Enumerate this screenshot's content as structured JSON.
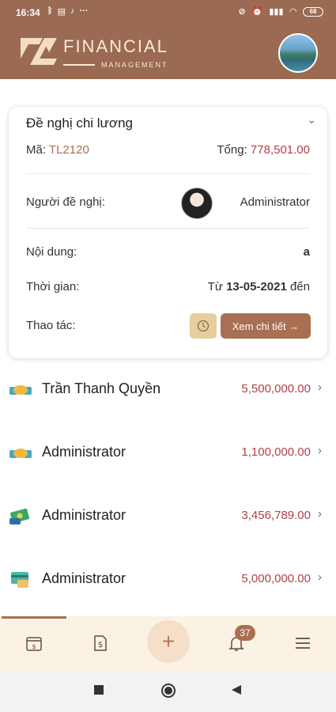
{
  "status_bar": {
    "time": "16:34",
    "left_icons": [
      "bluetooth-icon",
      "notes-icon",
      "tiktok-icon",
      "more-dots-icon"
    ],
    "right_icons": [
      "sync-off-icon",
      "alarm-icon",
      "signal-icon",
      "wifi-icon",
      "battery-icon"
    ],
    "battery_level": "68"
  },
  "header": {
    "brand_title": "FINANCIAL",
    "brand_subtitle": "MANAGEMENT"
  },
  "card": {
    "title": "Đề nghị chi lương",
    "code_label": "Mã:",
    "code_value": "TL2120",
    "total_label": "Tổng:",
    "total_value": "778,501.00",
    "requester_label": "Người đề nghị:",
    "requester_name": "Administrator",
    "content_label": "Nội dung:",
    "content_value": "a",
    "time_label": "Thời gian:",
    "time_from": "Từ",
    "time_date": "13-05-2021",
    "time_to": "đến",
    "action_label": "Thao tác:",
    "detail_button": "Xem chi tiết →"
  },
  "list": [
    {
      "name": "Trần Thanh Quyền",
      "amount": "5,500,000.00",
      "icon": "handshake-icon"
    },
    {
      "name": "Administrator",
      "amount": "1,100,000.00",
      "icon": "handshake-icon"
    },
    {
      "name": "Administrator",
      "amount": "3,456,789.00",
      "icon": "cash-icon"
    },
    {
      "name": "Administrator",
      "amount": "5,000,000.00",
      "icon": "card-payment-icon"
    }
  ],
  "bottom_nav": {
    "notification_count": "37",
    "plus_label": "+"
  },
  "colors": {
    "header_bg": "#9a6a52",
    "accent": "#a86f52",
    "amount_red": "#b0404a",
    "nav_bg": "#fbf2e6"
  }
}
